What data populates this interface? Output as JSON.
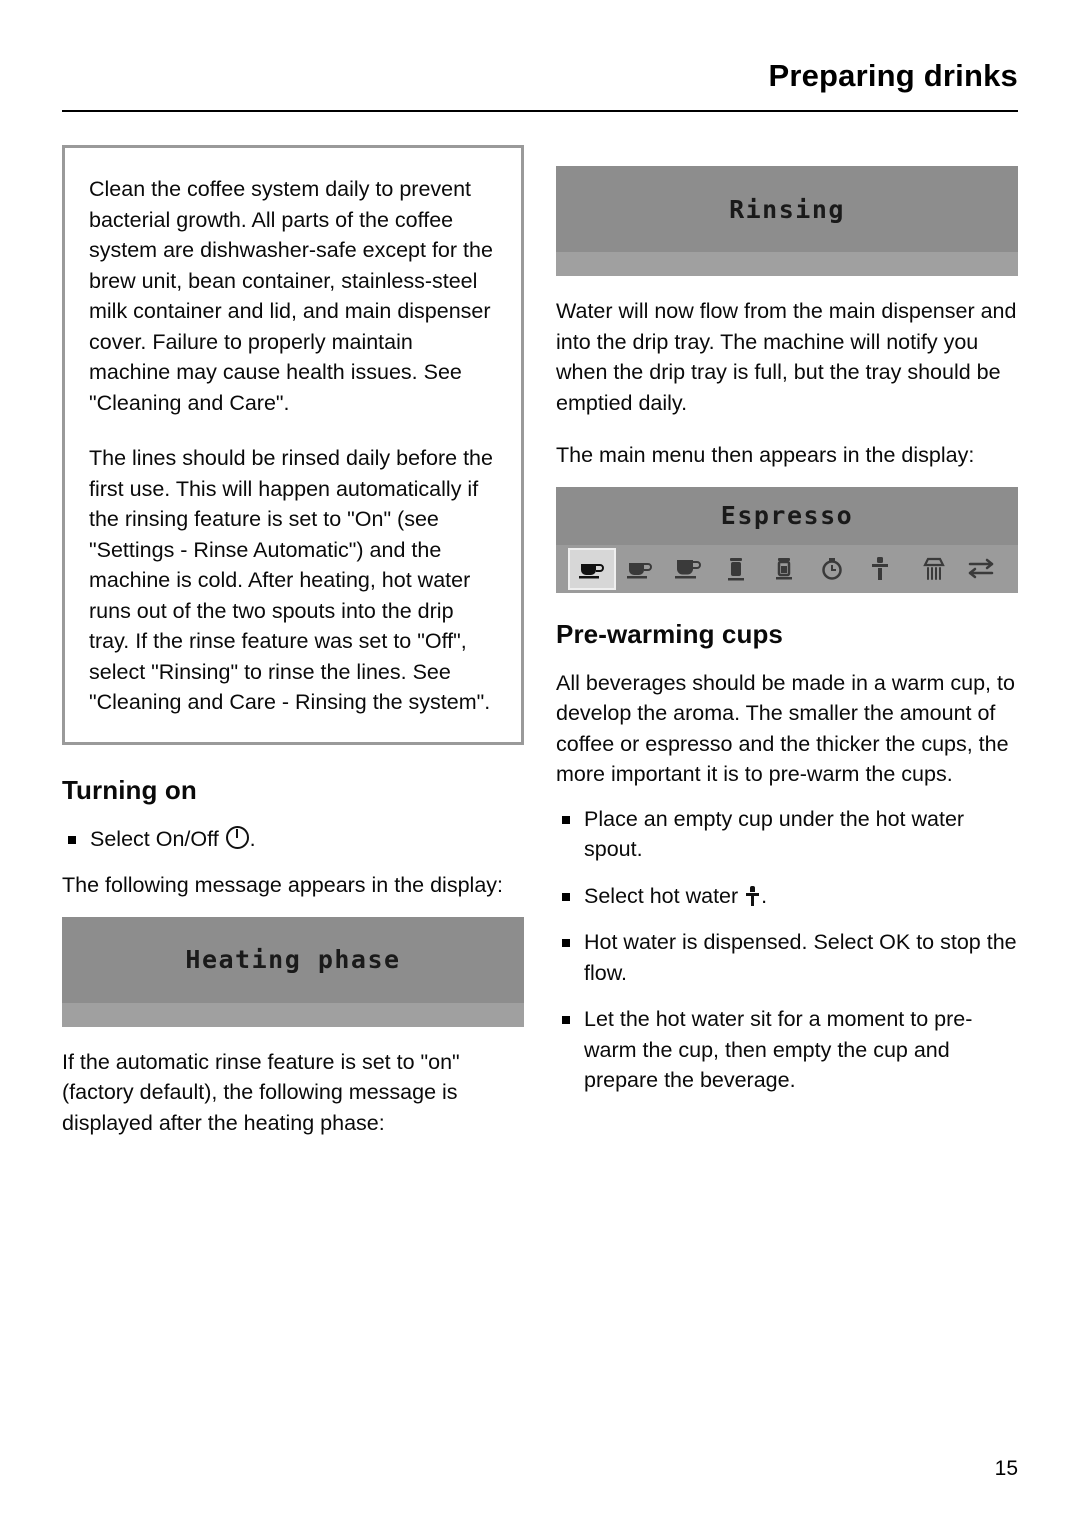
{
  "header": {
    "title": "Preparing drinks"
  },
  "left_column": {
    "note_box": {
      "paragraphs": [
        "Clean the coffee system daily to prevent bacterial growth. All parts of the coffee system are dishwasher-safe except for the brew unit, bean container, stainless-steel milk container and lid, and main dispenser cover. Failure to properly maintain machine may cause health issues. See \"Cleaning and Care\".",
        "The lines should be rinsed daily before the first use. This will happen automatically if the rinsing feature is set to \"On\" (see \"Settings - Rinse Automatic\") and the machine is cold. After heating, hot water runs out of the two spouts into the drip tray. If the rinse feature was set to \"Off\", select \"Rinsing\" to rinse the lines. See \"Cleaning and Care - Rinsing the system\"."
      ]
    },
    "heading": "Turning on",
    "bullets": [
      "Select On/Off "
    ],
    "bullet_suffix": ".",
    "paragraph_after_bullet": "The following message appears in the display:",
    "display_heating": "Heating phase",
    "paragraph_after_display": "If the automatic rinse feature is set to \"on\" (factory default), the following message is displayed after the heating phase:"
  },
  "right_column": {
    "display_rinsing": "Rinsing",
    "paragraph_1": "Water will now flow from the main dispenser and into the drip tray. The machine will notify you when the drip tray is full, but the tray should be emptied daily.",
    "paragraph_2": "The main menu then appears in the display:",
    "display_espresso": "Espresso",
    "icons": [
      "espresso-cup-icon",
      "coffee-cup-icon",
      "long-coffee-icon",
      "cappuccino-icon",
      "latte-macchiato-icon",
      "timer-icon",
      "hot-water-icon",
      "rinse-shower-icon",
      "settings-sliders-icon"
    ],
    "heading": "Pre-warming cups",
    "paragraph_3": "All beverages should be made in a warm cup, to develop the aroma. The smaller the amount of coffee or espresso and the thicker the cups, the more important it is to pre-warm the cups.",
    "bullets": [
      "Place an empty cup under the hot water spout.",
      "Select hot water ",
      "Hot water is dispensed. Select OK to stop the flow.",
      "Let the hot water sit for a moment to pre-warm the cup, then empty the cup and prepare the beverage."
    ],
    "bullet_2_suffix": "."
  },
  "footer": {
    "page_number": "15"
  }
}
